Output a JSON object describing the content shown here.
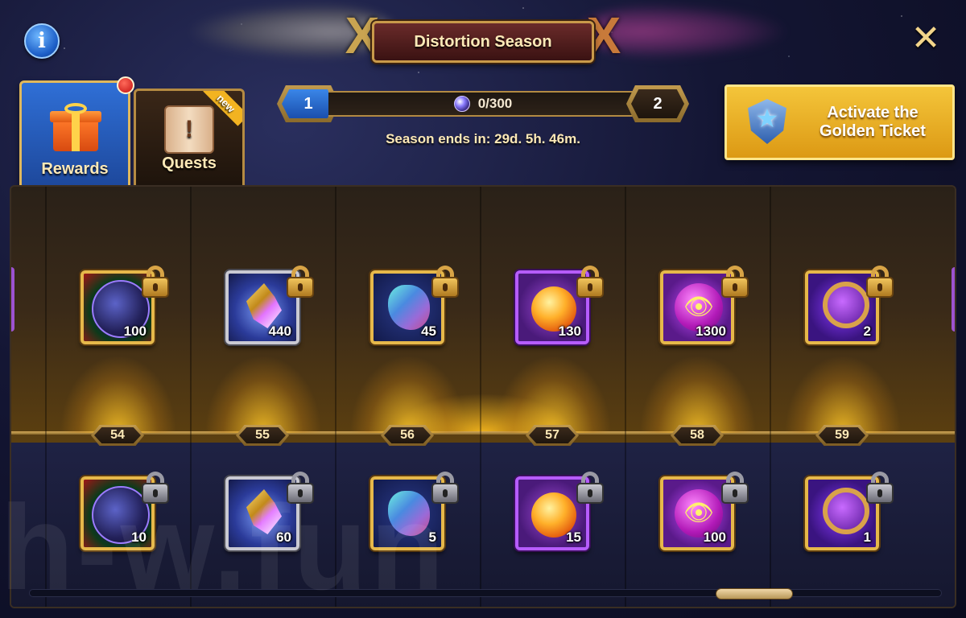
{
  "header": {
    "title": "Distortion Season",
    "info_icon": "info-icon",
    "close_icon": "close-icon"
  },
  "tabs": [
    {
      "label": "Rewards",
      "icon": "gift-icon",
      "active": true,
      "notification": true
    },
    {
      "label": "Quests",
      "icon": "scroll-icon",
      "active": false,
      "badge": "new"
    }
  ],
  "progress": {
    "current_level": "1",
    "next_level": "2",
    "points": "0/300",
    "fraction": 0,
    "currency_icon": "orb-icon",
    "season_ends": "Season ends in: 29d. 5h. 46m."
  },
  "golden_ticket": {
    "label": "Activate the Golden Ticket",
    "icon": "golden-ticket-emblem-icon"
  },
  "columns": [
    {
      "level": "54",
      "top": {
        "item": "orb",
        "frame": "gold",
        "qty": "100"
      },
      "bottom": {
        "item": "orb",
        "frame": "gold",
        "qty": "10"
      }
    },
    {
      "level": "55",
      "top": {
        "item": "shards",
        "frame": "silver",
        "qty": "440"
      },
      "bottom": {
        "item": "shards",
        "frame": "silver",
        "qty": "60"
      }
    },
    {
      "level": "56",
      "top": {
        "item": "ore",
        "frame": "gold",
        "qty": "45"
      },
      "bottom": {
        "item": "ore",
        "frame": "gold",
        "qty": "5"
      }
    },
    {
      "level": "57",
      "top": {
        "item": "potion",
        "frame": "purple",
        "qty": "130"
      },
      "bottom": {
        "item": "potion",
        "frame": "purple",
        "qty": "15"
      }
    },
    {
      "level": "58",
      "top": {
        "item": "eye",
        "frame": "gold",
        "qty": "1300"
      },
      "bottom": {
        "item": "eye",
        "frame": "gold",
        "qty": "100"
      }
    },
    {
      "level": "59",
      "top": {
        "item": "lens",
        "frame": "gold",
        "qty": "2"
      },
      "bottom": {
        "item": "lens",
        "frame": "gold",
        "qty": "1"
      }
    }
  ],
  "locks": {
    "top": "gold-lock-icon",
    "bottom": "grey-lock-icon"
  },
  "watermark": "h-w.fun",
  "colors": {
    "accent_gold": "#e6b84a",
    "tab_blue": "#2f6fd6",
    "golden_button": "#f4c53a",
    "purple_frame": "#b65cff"
  }
}
